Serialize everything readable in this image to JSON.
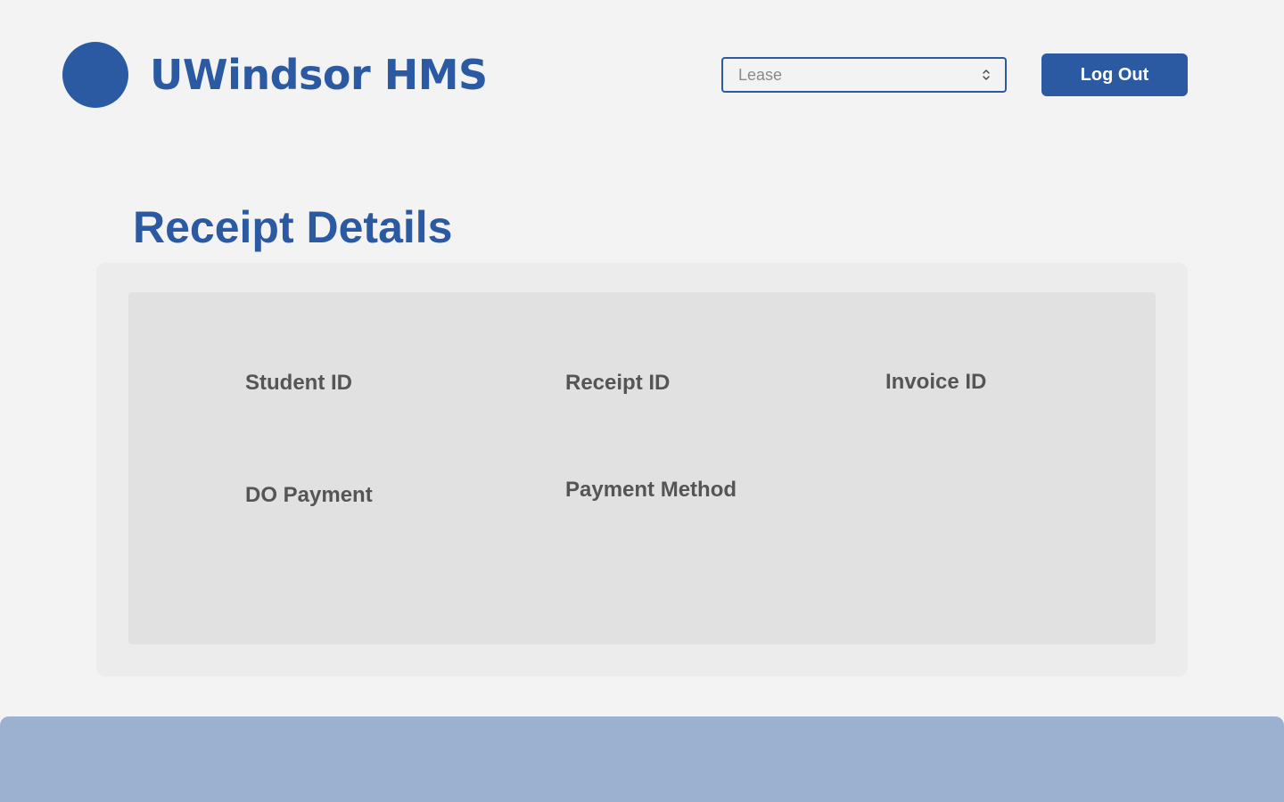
{
  "header": {
    "app_title": "UWindsor HMS",
    "select": {
      "selected_value": "Lease",
      "options": [
        "Lease"
      ]
    },
    "logout_label": "Log Out"
  },
  "main": {
    "section_title": "Receipt Details",
    "fields": {
      "student_id_label": "Student ID",
      "receipt_id_label": "Receipt ID",
      "invoice_id_label": "Invoice ID",
      "do_payment_label": "DO Payment",
      "payment_method_label": "Payment Method"
    }
  },
  "colors": {
    "brand": "#2b5aa3",
    "page_background": "#f3f3f4",
    "card_outer": "#ececec",
    "card_inner": "#e1e1e1",
    "label_text": "#555555",
    "footer": "#9cb0d0"
  },
  "icons": {
    "logo": "logo-circle",
    "select_arrows": "chevron-up-down-icon"
  }
}
